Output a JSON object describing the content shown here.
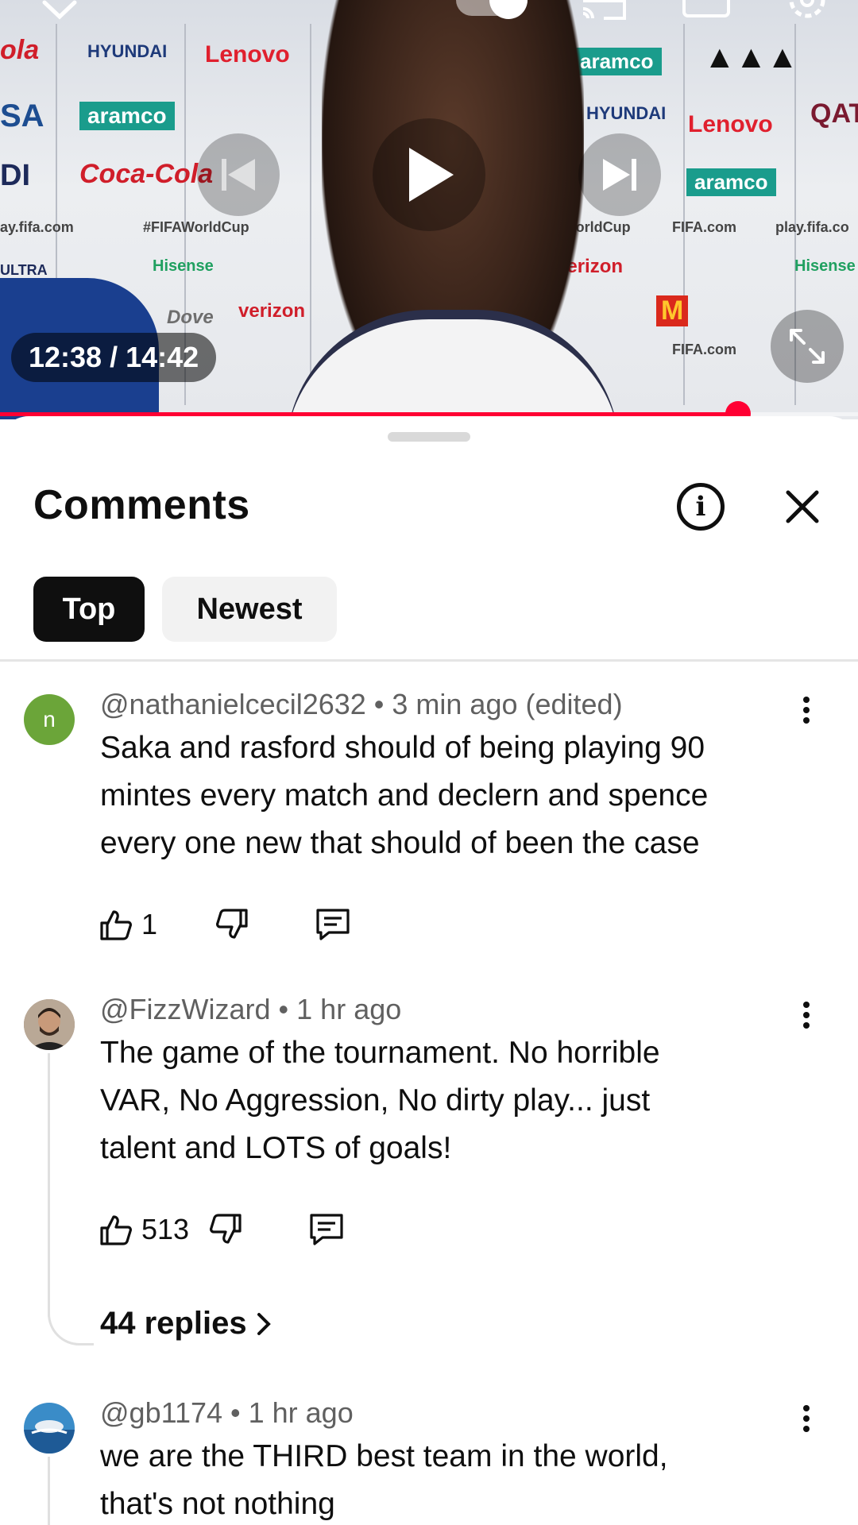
{
  "player": {
    "time_current": "12:38",
    "time_total": "14:42",
    "time_display": "12:38 / 14:42",
    "progress": 0.86,
    "accent": "#ff0033"
  },
  "sheet": {
    "title": "Comments",
    "filters": [
      {
        "label": "Top",
        "selected": true
      },
      {
        "label": "Newest",
        "selected": false
      }
    ]
  },
  "comments": [
    {
      "avatar_letter": "n",
      "avatar_color": "#6ba539",
      "author": "@nathanielcecil2632",
      "time": "3 min ago (edited)",
      "lines": [
        "Saka and rasford should of being playing 90",
        "mintes every match and declern  and spence",
        "every one new that should of been the case"
      ],
      "likes": "1"
    },
    {
      "author": "@FizzWizard",
      "time": "1 hr ago",
      "lines": [
        "The game of the tournament. No horrible",
        "VAR, No Aggression, No dirty play... just",
        "talent and LOTS of goals!"
      ],
      "likes": "513",
      "replies": "44 replies"
    },
    {
      "author": "@gb1174",
      "time": "1 hr ago",
      "lines": [
        "we are the THIRD best team in the world,",
        "that's not nothing"
      ]
    }
  ]
}
